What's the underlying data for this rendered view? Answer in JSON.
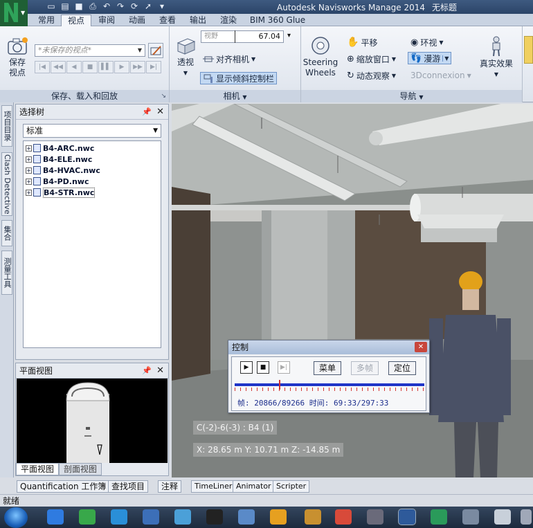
{
  "window": {
    "title_app": "Autodesk Navisworks Manage 2014",
    "title_doc": "无标题"
  },
  "ribbon_tabs": [
    {
      "label": "常用",
      "active": false
    },
    {
      "label": "视点",
      "active": true
    },
    {
      "label": "审阅",
      "active": false
    },
    {
      "label": "动画",
      "active": false
    },
    {
      "label": "查看",
      "active": false
    },
    {
      "label": "输出",
      "active": false
    },
    {
      "label": "渲染",
      "active": false
    },
    {
      "label": "BIM 360 Glue",
      "active": false
    }
  ],
  "ribbon": {
    "save_panel": {
      "save_view_label": "保存\n视点",
      "saved_view_placeholder": "*未保存的视点*",
      "panel_label": "保存、载入和回放"
    },
    "camera_panel": {
      "perspective_label": "透视",
      "fov_label": "视野",
      "fov_value": "67.04",
      "align_camera_label": "对齐相机",
      "show_tilt_bar_label": "显示倾斜控制栏",
      "panel_label": "相机"
    },
    "nav_panel": {
      "steering_wheels_label": "Steering\nWheels",
      "pan_label": "平移",
      "zoom_window_label": "缩放窗口",
      "orbit_label": "动态观察",
      "look_around_label": "环视",
      "walk_label": "漫游",
      "connexion_label": "3Dconnexion",
      "realism_label": "真实效果",
      "panel_label": "导航"
    }
  },
  "left_vertical_tabs": [
    "项目目录",
    "Clash Detective",
    "集合",
    "测量工具"
  ],
  "selection_tree": {
    "title": "选择树",
    "mode": "标准",
    "items": [
      "B4-ARC.nwc",
      "B4-ELE.nwc",
      "B4-HVAC.nwc",
      "B4-PD.nwc",
      "B4-STR.nwc"
    ]
  },
  "plan_view": {
    "title": "平面视图",
    "tabs": [
      "平面视图",
      "剖面视图"
    ]
  },
  "control_dialog": {
    "title": "控制",
    "menu_label": "菜单",
    "multi_frame_label": "多帧",
    "locate_label": "定位",
    "frame_info": "帧: 20866/89266 时间: 69:33/297:33",
    "progress": 0.234
  },
  "viewport": {
    "grid_location": "C(-2)-6(-3) : B4 (1)",
    "coordinates": "X: 28.65 m  Y: 10.71 m  Z: -14.85 m"
  },
  "bottom_tabs": [
    "Quantification 工作簿",
    "查找项目",
    "注释",
    "TimeLiner",
    "Animator",
    "Scripter"
  ],
  "status": {
    "text": "就绪"
  },
  "colors": {
    "accent_blue": "#1f35c8",
    "tick_red": "#d23030",
    "frame_text": "#1b2d8c"
  }
}
